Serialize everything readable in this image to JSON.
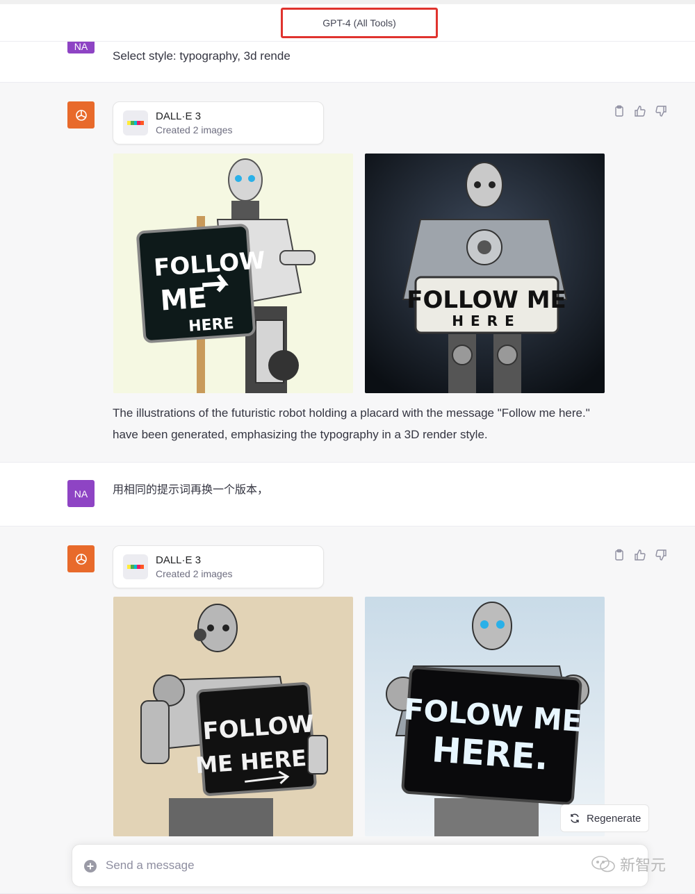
{
  "header": {
    "model_title": "GPT-4 (All Tools)"
  },
  "user_msg_1": {
    "avatar": "NA",
    "text": "Select style: typography, 3d rende"
  },
  "assistant_1": {
    "tool": {
      "name": "DALL·E 3",
      "status": "Created 2 images"
    },
    "images": [
      {
        "sign_lines": [
          "FOLLOW",
          "ME",
          "HERE"
        ],
        "palette": "cream"
      },
      {
        "sign_lines": [
          "FOLLOW ME",
          "HERE"
        ],
        "palette": "dark"
      }
    ],
    "text_line_1": "The illustrations of the futuristic robot holding a placard with the message \"Follow me here.\"",
    "text_line_2": "have been generated, emphasizing the typography in a 3D render style."
  },
  "user_msg_2": {
    "avatar": "NA",
    "text": "用相同的提示词再换一个版本，"
  },
  "assistant_2": {
    "tool": {
      "name": "DALL·E 3",
      "status": "Created 2 images"
    },
    "images": [
      {
        "sign_lines": [
          "FOLLOW",
          "ME HERE.."
        ],
        "palette": "beige"
      },
      {
        "sign_lines": [
          "FOLOW ME",
          "HERE."
        ],
        "palette": "blue"
      }
    ]
  },
  "regenerate_label": "Regenerate",
  "composer": {
    "placeholder": "Send a message"
  },
  "watermark": "新智元",
  "colors": {
    "user_avatar": "#8e44c4",
    "assistant_avatar": "#e86a2b",
    "highlight_box": "#e0332e"
  },
  "icons": [
    "clipboard-icon",
    "thumbs-up-icon",
    "thumbs-down-icon",
    "openai-logo-icon",
    "plus-circle-icon",
    "refresh-icon",
    "dalle-icon"
  ]
}
